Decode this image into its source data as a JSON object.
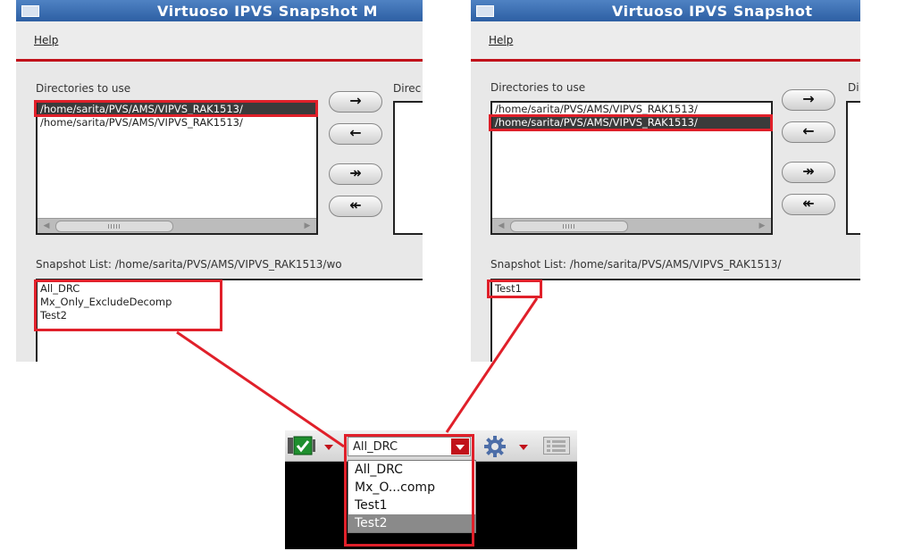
{
  "left_window": {
    "title": "Virtuoso IPVS Snapshot M",
    "menu_help": "Help",
    "dirs_label": "Directories to use",
    "right_clip_label": "Direc",
    "dirs": [
      "/home/sarita/PVS/AMS/VIPVS_RAK1513/",
      "/home/sarita/PVS/AMS/VIPVS_RAK1513/"
    ],
    "selected_dir_index": 0,
    "snapshot_label": "Snapshot List: /home/sarita/PVS/AMS/VIPVS_RAK1513/wo",
    "snapshots": [
      "All_DRC",
      "Mx_Only_ExcludeDecomp",
      "Test2"
    ]
  },
  "right_window": {
    "title": "Virtuoso IPVS Snapshot",
    "menu_help": "Help",
    "dirs_label": "Directories to use",
    "right_clip_label": "Di",
    "dirs": [
      "/home/sarita/PVS/AMS/VIPVS_RAK1513/",
      "/home/sarita/PVS/AMS/VIPVS_RAK1513/"
    ],
    "selected_dir_index": 1,
    "snapshot_label": "Snapshot List: /home/sarita/PVS/AMS/VIPVS_RAK1513/",
    "snapshots": [
      "Test1"
    ]
  },
  "transfer_buttons": {
    "add": "→",
    "remove": "←",
    "add_all": "↠",
    "remove_all": "↞"
  },
  "toolbar": {
    "combo_value": "All_DRC",
    "options": [
      "All_DRC",
      "Mx_O...comp",
      "Test1",
      "Test2"
    ],
    "highlighted_option_index": 3
  },
  "colors": {
    "highlight_red": "#e0202a",
    "selection": "#3b3b3b",
    "title_blue": "#2d5fa3"
  }
}
